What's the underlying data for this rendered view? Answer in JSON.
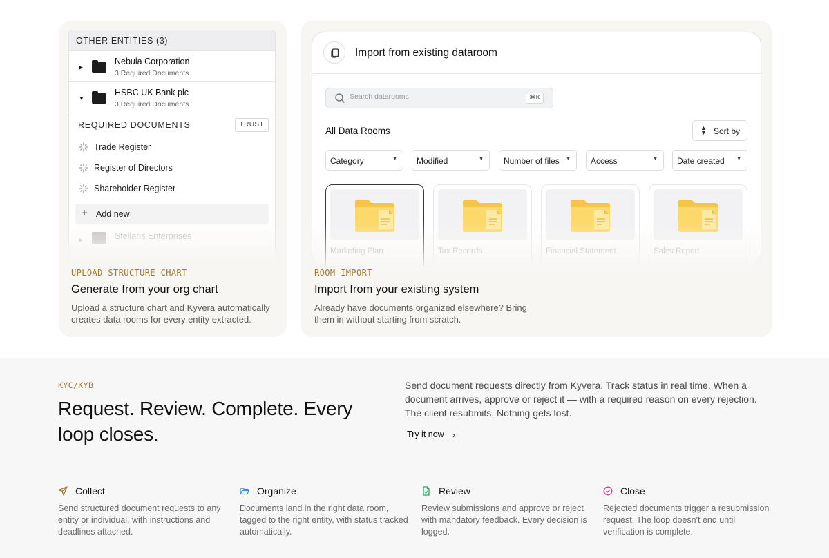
{
  "left_card": {
    "panel_header": "OTHER ENTITIES (3)",
    "entities": [
      {
        "name": "Nebula Corporation",
        "sub": "3 Required Documents",
        "caret": "▶"
      },
      {
        "name": "HSBC UK Bank plc",
        "sub": "3 Required Documents",
        "caret": "▼"
      }
    ],
    "required_label": "REQUIRED DOCUMENTS",
    "trust_badge": "TRUST",
    "documents": [
      "Trade Register",
      "Register of Directors",
      "Shareholder Register"
    ],
    "add_new": "Add new",
    "ghost_entity": "Stellaris Enterprises",
    "caption_label": "UPLOAD STRUCTURE CHART",
    "caption_title": "Generate from your org chart",
    "caption_desc": "Upload a structure chart and Kyvera automatically creates data rooms for every entity extracted."
  },
  "right_card": {
    "panel_title": "Import from existing dataroom",
    "search_placeholder": "Search datarooms",
    "search_shortcut": "⌘K",
    "rooms_title": "All Data Rooms",
    "sort_label": "Sort by",
    "filters": [
      "Category",
      "Modified",
      "Number of files",
      "Access",
      "Date created"
    ],
    "rooms": [
      "Marketing Plan",
      "Tax Records",
      "Financial Statement",
      "Sales Report"
    ],
    "caption_label": "ROOM IMPORT",
    "caption_title": "Import from your existing system",
    "caption_desc": "Already have documents organized elsewhere? Bring them in without starting from scratch."
  },
  "kyc": {
    "label": "KYC/KYB",
    "headline": "Request. Review. Complete. Every loop closes.",
    "lead": "Send document requests directly from Kyvera. Track status in real time. When a document arrives, approve or reject it — with a required reason on every rejection. The client resubmits. Nothing gets lost.",
    "cta": "Try it now",
    "features": [
      {
        "title": "Collect",
        "desc": "Send structured document requests to any entity or individual, with instructions and deadlines attached.",
        "icon": "send-icon",
        "color": "#a37a2e"
      },
      {
        "title": "Organize",
        "desc": "Documents land in the right data room, tagged to the right entity, with status tracked automatically.",
        "icon": "folder-open-icon",
        "color": "#3a8fd6"
      },
      {
        "title": "Review",
        "desc": "Review submissions and approve or reject with mandatory feedback. Every decision is logged.",
        "icon": "file-check-icon",
        "color": "#2fa36b"
      },
      {
        "title": "Close",
        "desc": "Rejected documents trigger a resubmission request. The loop doesn't end until verification is complete.",
        "icon": "circle-check-icon",
        "color": "#d63a8a"
      }
    ]
  },
  "colors": {
    "accent_gold": "#a37a2e",
    "folder_yellow": "#f7c948"
  }
}
